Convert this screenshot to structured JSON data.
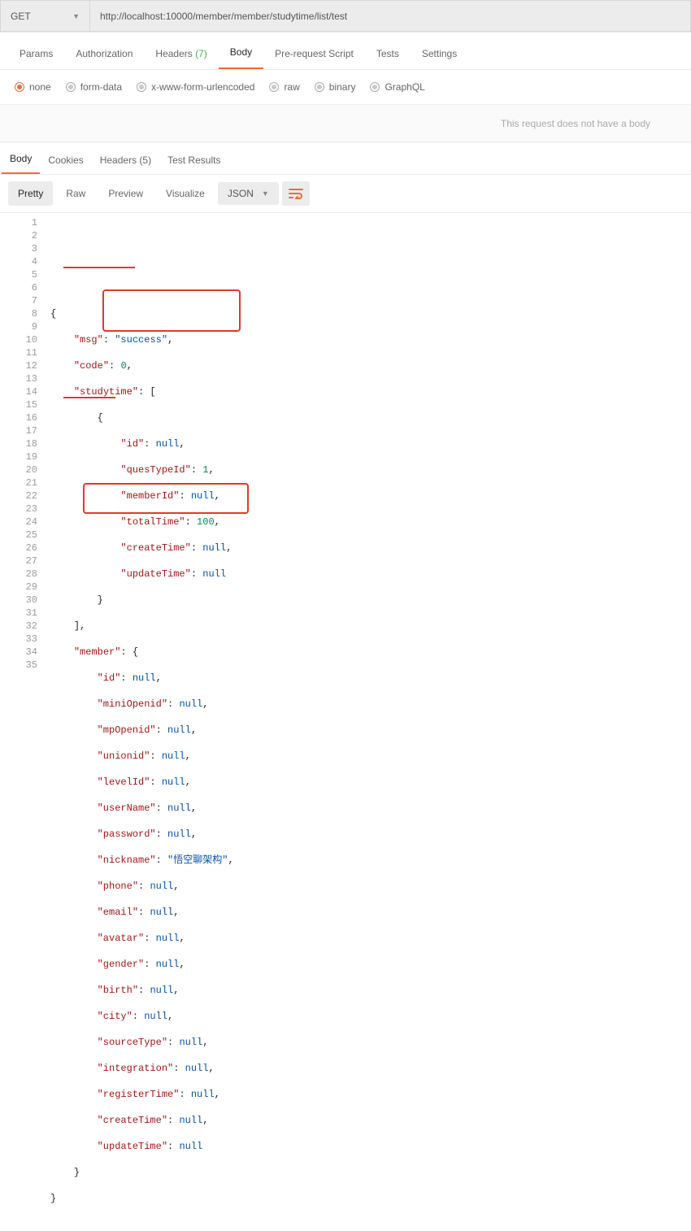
{
  "request": {
    "method": "GET",
    "url": "http://localhost:10000/member/member/studytime/list/test"
  },
  "reqTabs": {
    "params": "Params",
    "authorization": "Authorization",
    "headers_label": "Headers",
    "headers_count": "(7)",
    "body": "Body",
    "prerequest": "Pre-request Script",
    "tests": "Tests",
    "settings": "Settings"
  },
  "bodyTypes": {
    "none": "none",
    "formdata": "form-data",
    "xwww": "x-www-form-urlencoded",
    "raw": "raw",
    "binary": "binary",
    "graphql": "GraphQL"
  },
  "noBody": "This request does not have a body",
  "respTabs": {
    "body": "Body",
    "cookies": "Cookies",
    "headers_label": "Headers",
    "headers_count": "(5)",
    "testresults": "Test Results"
  },
  "viewer": {
    "pretty": "Pretty",
    "raw": "Raw",
    "preview": "Preview",
    "visualize": "Visualize",
    "format": "JSON"
  },
  "json": {
    "msg_k": "\"msg\"",
    "msg_v": "\"success\"",
    "code_k": "\"code\"",
    "code_v": "0",
    "studytime_k": "\"studytime\"",
    "st_id_k": "\"id\"",
    "st_id_v": "null",
    "st_quesTypeId_k": "\"quesTypeId\"",
    "st_quesTypeId_v": "1",
    "st_memberId_k": "\"memberId\"",
    "st_memberId_v": "null",
    "st_totalTime_k": "\"totalTime\"",
    "st_totalTime_v": "100",
    "st_createTime_k": "\"createTime\"",
    "st_createTime_v": "null",
    "st_updateTime_k": "\"updateTime\"",
    "st_updateTime_v": "null",
    "member_k": "\"member\"",
    "m_id_k": "\"id\"",
    "m_id_v": "null",
    "m_miniOpenid_k": "\"miniOpenid\"",
    "m_miniOpenid_v": "null",
    "m_mpOpenid_k": "\"mpOpenid\"",
    "m_mpOpenid_v": "null",
    "m_unionid_k": "\"unionid\"",
    "m_unionid_v": "null",
    "m_levelId_k": "\"levelId\"",
    "m_levelId_v": "null",
    "m_userName_k": "\"userName\"",
    "m_userName_v": "null",
    "m_password_k": "\"password\"",
    "m_password_v": "null",
    "m_nickname_k": "\"nickname\"",
    "m_nickname_v": "\"悟空聊架构\"",
    "m_phone_k": "\"phone\"",
    "m_phone_v": "null",
    "m_email_k": "\"email\"",
    "m_email_v": "null",
    "m_avatar_k": "\"avatar\"",
    "m_avatar_v": "null",
    "m_gender_k": "\"gender\"",
    "m_gender_v": "null",
    "m_birth_k": "\"birth\"",
    "m_birth_v": "null",
    "m_city_k": "\"city\"",
    "m_city_v": "null",
    "m_sourceType_k": "\"sourceType\"",
    "m_sourceType_v": "null",
    "m_integration_k": "\"integration\"",
    "m_integration_v": "null",
    "m_registerTime_k": "\"registerTime\"",
    "m_registerTime_v": "null",
    "m_createTime_k": "\"createTime\"",
    "m_createTime_v": "null",
    "m_updateTime_k": "\"updateTime\"",
    "m_updateTime_v": "null"
  }
}
